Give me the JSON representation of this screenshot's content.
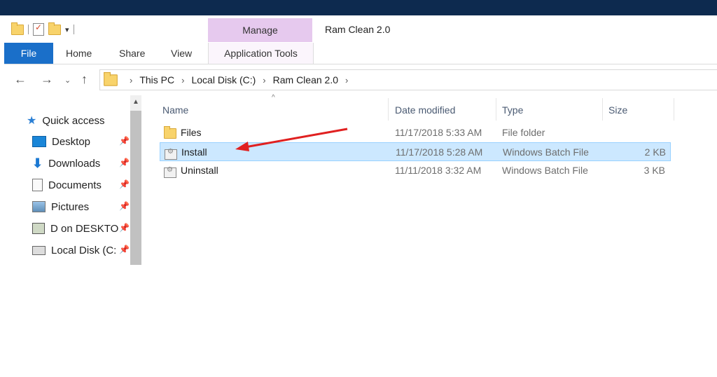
{
  "window": {
    "title": "Ram Clean 2.0",
    "context_tab_group": "Manage"
  },
  "ribbon": {
    "tabs": [
      "File",
      "Home",
      "Share",
      "View"
    ],
    "context_tab": "Application Tools"
  },
  "address_bar": {
    "crumbs": [
      "This PC",
      "Local Disk (C:)",
      "Ram Clean 2.0"
    ]
  },
  "nav_pane": {
    "header": "Quick access",
    "items": [
      {
        "label": "Desktop",
        "icon": "desktop-icon"
      },
      {
        "label": "Downloads",
        "icon": "downloads-icon"
      },
      {
        "label": "Documents",
        "icon": "documents-icon"
      },
      {
        "label": "Pictures",
        "icon": "pictures-icon"
      },
      {
        "label": "D on DESKTO",
        "icon": "network-drive-icon"
      },
      {
        "label": "Local Disk (C:",
        "icon": "local-disk-icon"
      }
    ]
  },
  "file_list": {
    "columns": [
      "Name",
      "Date modified",
      "Type",
      "Size"
    ],
    "rows": [
      {
        "name": "Files",
        "date": "11/17/2018 5:33 AM",
        "type": "File folder",
        "size": "",
        "icon": "folder-icon",
        "selected": false
      },
      {
        "name": "Install",
        "date": "11/17/2018 5:28 AM",
        "type": "Windows Batch File",
        "size": "2 KB",
        "icon": "batch-file-icon",
        "selected": true
      },
      {
        "name": "Uninstall",
        "date": "11/11/2018 3:32 AM",
        "type": "Windows Batch File",
        "size": "3 KB",
        "icon": "batch-file-icon",
        "selected": false
      }
    ]
  },
  "colors": {
    "file_tab": "#1a6fc9",
    "manage_tab": "#e6c9ee",
    "selection": "#cce8ff",
    "annotation_arrow": "#e02020"
  }
}
